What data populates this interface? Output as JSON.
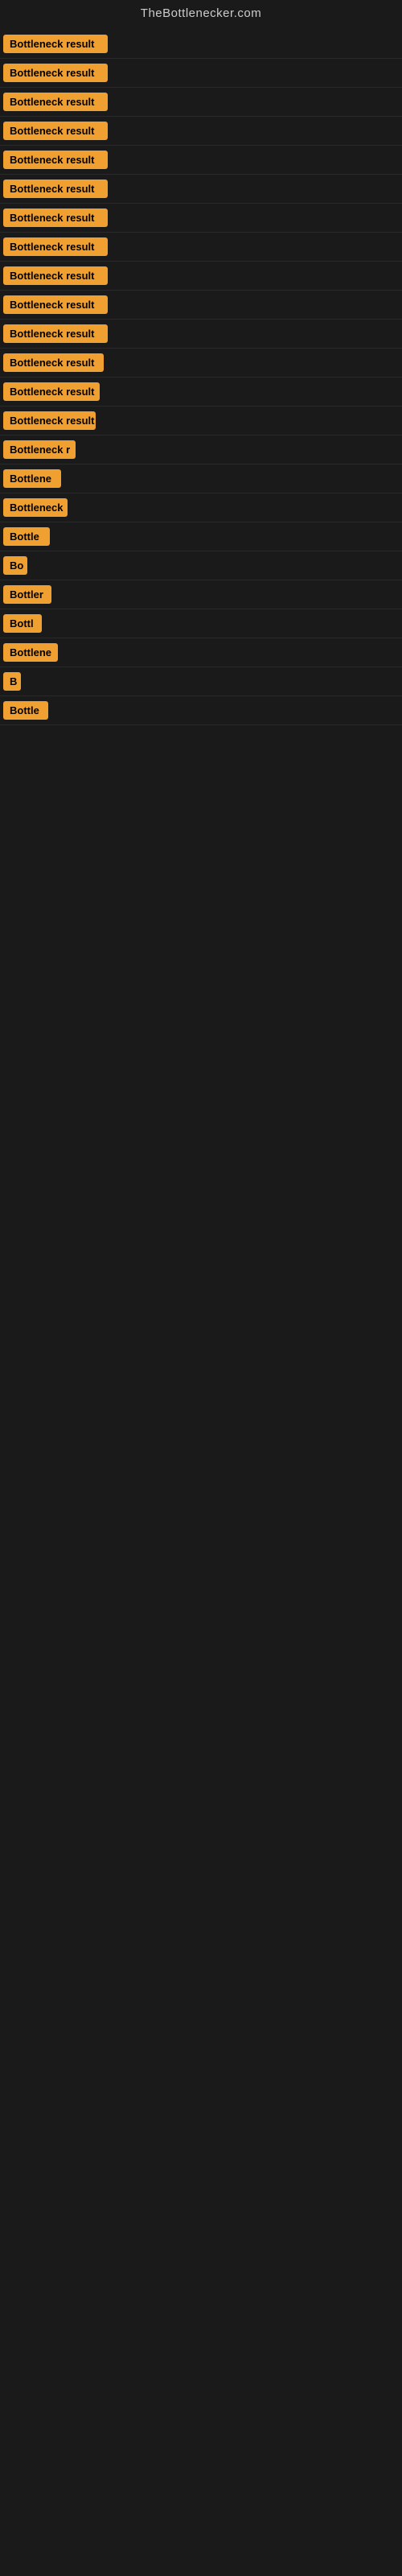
{
  "site": {
    "title": "TheBottlenecker.com"
  },
  "rows": [
    {
      "id": 1,
      "label": "Bottleneck result",
      "width": 130
    },
    {
      "id": 2,
      "label": "Bottleneck result",
      "width": 130
    },
    {
      "id": 3,
      "label": "Bottleneck result",
      "width": 130
    },
    {
      "id": 4,
      "label": "Bottleneck result",
      "width": 130
    },
    {
      "id": 5,
      "label": "Bottleneck result",
      "width": 130
    },
    {
      "id": 6,
      "label": "Bottleneck result",
      "width": 130
    },
    {
      "id": 7,
      "label": "Bottleneck result",
      "width": 130
    },
    {
      "id": 8,
      "label": "Bottleneck result",
      "width": 130
    },
    {
      "id": 9,
      "label": "Bottleneck result",
      "width": 130
    },
    {
      "id": 10,
      "label": "Bottleneck result",
      "width": 130
    },
    {
      "id": 11,
      "label": "Bottleneck result",
      "width": 130
    },
    {
      "id": 12,
      "label": "Bottleneck result",
      "width": 125
    },
    {
      "id": 13,
      "label": "Bottleneck result",
      "width": 120
    },
    {
      "id": 14,
      "label": "Bottleneck result",
      "width": 115
    },
    {
      "id": 15,
      "label": "Bottleneck r",
      "width": 90
    },
    {
      "id": 16,
      "label": "Bottlene",
      "width": 72
    },
    {
      "id": 17,
      "label": "Bottleneck",
      "width": 80
    },
    {
      "id": 18,
      "label": "Bottle",
      "width": 58
    },
    {
      "id": 19,
      "label": "Bo",
      "width": 30
    },
    {
      "id": 20,
      "label": "Bottler",
      "width": 60
    },
    {
      "id": 21,
      "label": "Bottl",
      "width": 48
    },
    {
      "id": 22,
      "label": "Bottlene",
      "width": 68
    },
    {
      "id": 23,
      "label": "B",
      "width": 22
    },
    {
      "id": 24,
      "label": "Bottle",
      "width": 56
    }
  ],
  "colors": {
    "badge_bg": "#f0a030",
    "badge_text": "#000000",
    "background": "#1a1a1a",
    "title_text": "#cccccc"
  }
}
